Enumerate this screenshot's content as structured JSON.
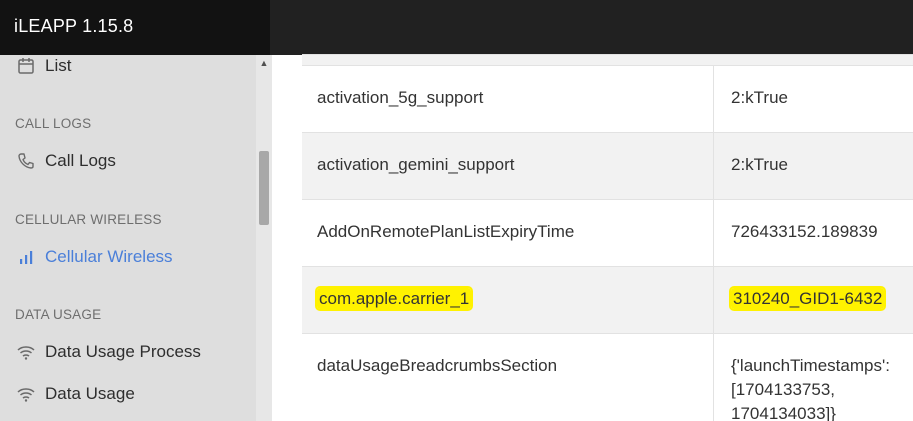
{
  "app": {
    "title": "iLEAPP 1.15.8"
  },
  "sidebar": {
    "items": [
      {
        "label": "List",
        "icon": "calendar-icon",
        "active": false
      },
      {
        "section": "CALL LOGS"
      },
      {
        "label": "Call Logs",
        "icon": "phone-icon",
        "active": false
      },
      {
        "section": "CELLULAR WIRELESS"
      },
      {
        "label": "Cellular Wireless",
        "icon": "signal-bars-icon",
        "active": true
      },
      {
        "section": "DATA USAGE"
      },
      {
        "label": "Data Usage Process",
        "icon": "wifi-icon",
        "active": false
      },
      {
        "label": "Data Usage",
        "icon": "wifi-icon",
        "active": false
      }
    ]
  },
  "table": {
    "rows": [
      {
        "key": "activation_5g_support",
        "value": "2:kTrue",
        "highlighted": false
      },
      {
        "key": "activation_gemini_support",
        "value": "2:kTrue",
        "highlighted": false
      },
      {
        "key": "AddOnRemotePlanListExpiryTime",
        "value": "726433152.189839",
        "highlighted": false
      },
      {
        "key": "com.apple.carrier_1",
        "value": "310240_GID1-6432",
        "highlighted": true
      },
      {
        "key": "dataUsageBreadcrumbsSection",
        "value_lines": [
          "{'launchTimestamps':",
          "[1704133753,",
          "1704134033]}"
        ],
        "highlighted": false
      }
    ]
  },
  "colors": {
    "accent": "#4a7fd9",
    "highlight": "#fff200",
    "header": "#212121"
  }
}
